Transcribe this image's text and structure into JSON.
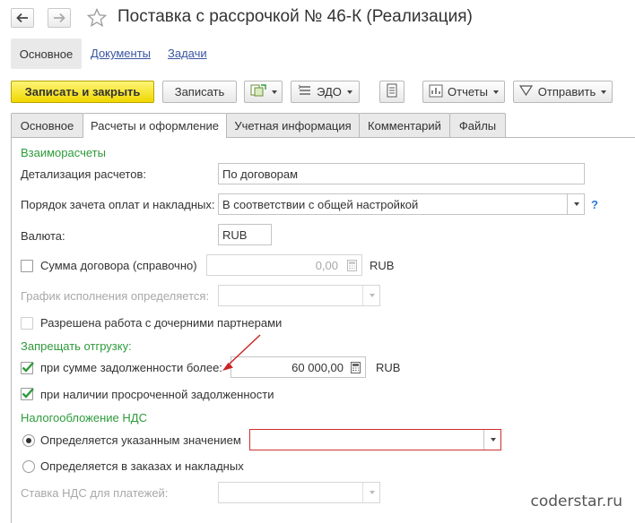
{
  "window": {
    "title": "Поставка с рассрочкой № 46-К (Реализация)"
  },
  "icons": {
    "back": "arrow-left-icon",
    "forward": "arrow-right-icon",
    "favorite": "star-icon"
  },
  "top_nav": {
    "items": [
      "Основное",
      "Документы",
      "Задачи"
    ],
    "active": "Основное"
  },
  "toolbar": {
    "save_close_label": "Записать и закрыть",
    "save_label": "Записать",
    "edo_label": "ЭДО",
    "reports_label": "Отчеты",
    "send_label": "Отправить",
    "accent_color": "#f0d800"
  },
  "tabs": {
    "items": [
      "Основное",
      "Расчеты и оформление",
      "Учетная информация",
      "Комментарий",
      "Файлы"
    ],
    "active": "Расчеты и оформление"
  },
  "form": {
    "settlements_header": "Взаиморасчеты",
    "detail_label": "Детализация расчетов:",
    "detail_value": "По договорам",
    "offset_label": "Порядок зачета оплат и накладных:",
    "offset_value": "В соответствии с общей настройкой",
    "help_mark": "?",
    "currency_label": "Валюта:",
    "currency_value": "RUB",
    "contract_sum_label": "Сумма договора (справочно)",
    "contract_sum_checked": false,
    "contract_sum_value": "0,00",
    "contract_sum_currency": "RUB",
    "schedule_label": "График исполнения определяется:",
    "schedule_value": "",
    "subsidiaries_label": "Разрешена работа с дочерними партнерами",
    "subsidiaries_checked": false,
    "ban_header": "Запрещать отгрузку:",
    "debt_label": "при сумме задолженности более:",
    "debt_checked": true,
    "debt_value": "60 000,00",
    "debt_currency": "RUB",
    "overdue_label": "при наличии просроченной задолженности",
    "overdue_checked": true,
    "vat_header": "Налогообложение НДС",
    "vat_option_1": "Определяется указанным значением",
    "vat_option_1_selected": true,
    "vat_value": "",
    "vat_option_2": "Определяется в заказах и накладных",
    "vat_option_2_selected": false,
    "vat_rate_label": "Ставка НДС для платежей:",
    "vat_rate_value": "",
    "section_color": "#2d9a3a",
    "arrow_color": "#cc2222"
  },
  "watermark": "coderstar.ru"
}
